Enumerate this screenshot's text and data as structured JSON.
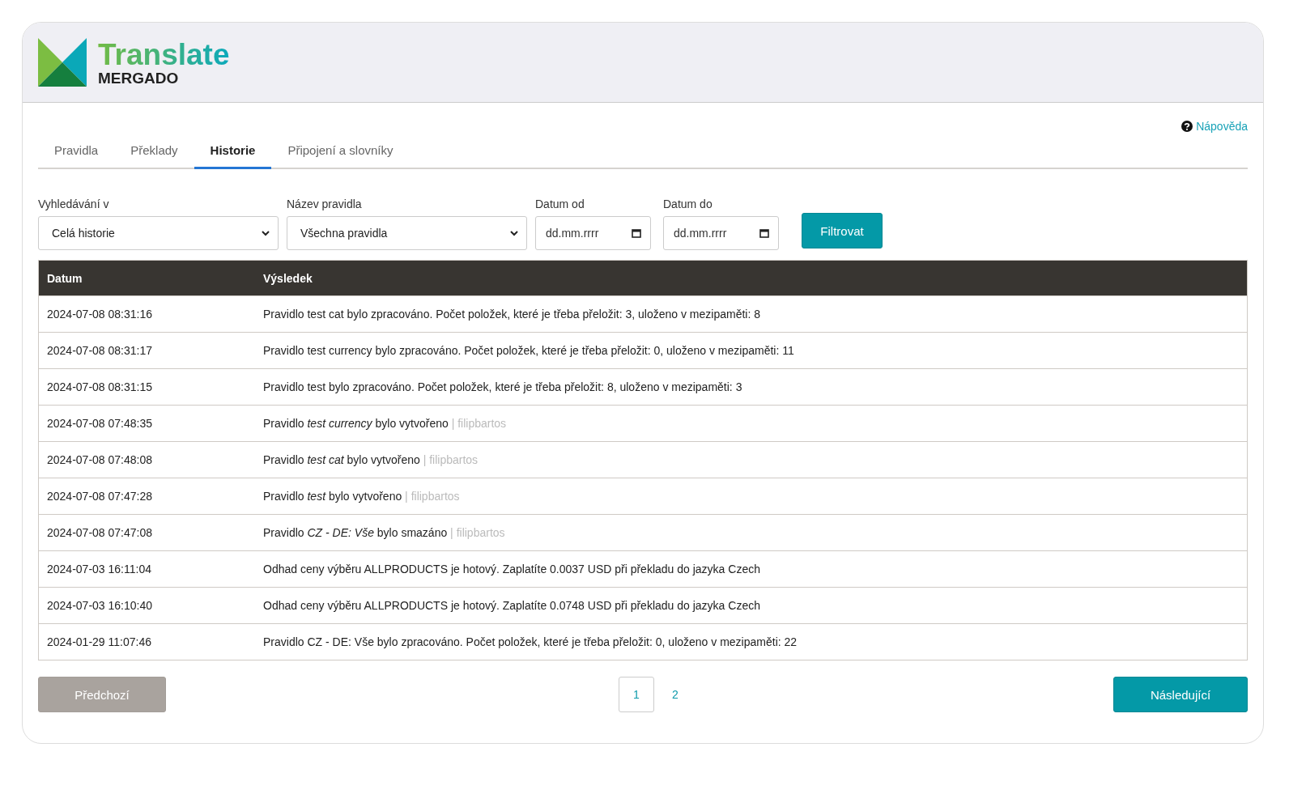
{
  "header": {
    "logo_title": "Translate",
    "logo_subtitle": "MERGADO"
  },
  "help_link": "Nápověda",
  "tabs": [
    {
      "label": "Pravidla",
      "selected": false
    },
    {
      "label": "Překlady",
      "selected": false
    },
    {
      "label": "Historie",
      "selected": true
    },
    {
      "label": "Připojení a slovníky",
      "selected": false
    }
  ],
  "filters": [
    {
      "kind": "select",
      "label": "Vyhledávání v",
      "value": "Celá historie"
    },
    {
      "kind": "select",
      "label": "Název pravidla",
      "value": "Všechna pravidla"
    },
    {
      "kind": "date",
      "label": "Datum od",
      "placeholder": "dd.mm.rrrr"
    },
    {
      "kind": "date",
      "label": "Datum do",
      "placeholder": "dd.mm.rrrr"
    }
  ],
  "filter_button": "Filtrovat",
  "table": {
    "columns": [
      "Datum",
      "Výsledek"
    ],
    "rows": [
      {
        "date": "2024-07-08 08:31:16",
        "result": "Pravidlo test cat bylo zpracováno. Počet položek, které je třeba přeložit: 3, uloženo v mezipaměti: 8"
      },
      {
        "date": "2024-07-08 08:31:17",
        "result": "Pravidlo test currency bylo zpracováno. Počet položek, které je třeba přeložit: 0, uloženo v mezipaměti: 11"
      },
      {
        "date": "2024-07-08 08:31:15",
        "result": "Pravidlo test bylo zpracováno. Počet položek, které je třeba přeložit: 8, uloženo v mezipaměti: 3"
      },
      {
        "date": "2024-07-08 07:48:35",
        "result": "Pravidlo *test currency* bylo vytvořeno",
        "author": "| filipbartos"
      },
      {
        "date": "2024-07-08 07:48:08",
        "result": "Pravidlo *test cat* bylo vytvořeno",
        "author": "| filipbartos"
      },
      {
        "date": "2024-07-08 07:47:28",
        "result": "Pravidlo *test* bylo vytvořeno",
        "author": "| filipbartos"
      },
      {
        "date": "2024-07-08 07:47:08",
        "result": "Pravidlo *CZ - DE: Vše* bylo smazáno",
        "author": "| filipbartos"
      },
      {
        "date": "2024-07-03 16:11:04",
        "result": "Odhad ceny výběru ALLPRODUCTS je hotový. Zaplatíte 0.0037 USD při překladu do jazyka Czech"
      },
      {
        "date": "2024-07-03 16:10:40",
        "result": "Odhad ceny výběru ALLPRODUCTS je hotový. Zaplatíte 0.0748 USD při překladu do jazyka Czech"
      },
      {
        "date": "2024-01-29 11:07:46",
        "result": "Pravidlo CZ - DE: Vše bylo zpracováno. Počet položek, které je třeba přeložit: 0, uloženo v mezipaměti: 22"
      }
    ]
  },
  "pagination": {
    "previous": {
      "label": "Předchozí",
      "disabled": true
    },
    "pages": [
      {
        "label": "1",
        "selected": true
      },
      {
        "label": "2",
        "selected": false
      }
    ],
    "next": {
      "label": "Následující",
      "disabled": false
    }
  }
}
